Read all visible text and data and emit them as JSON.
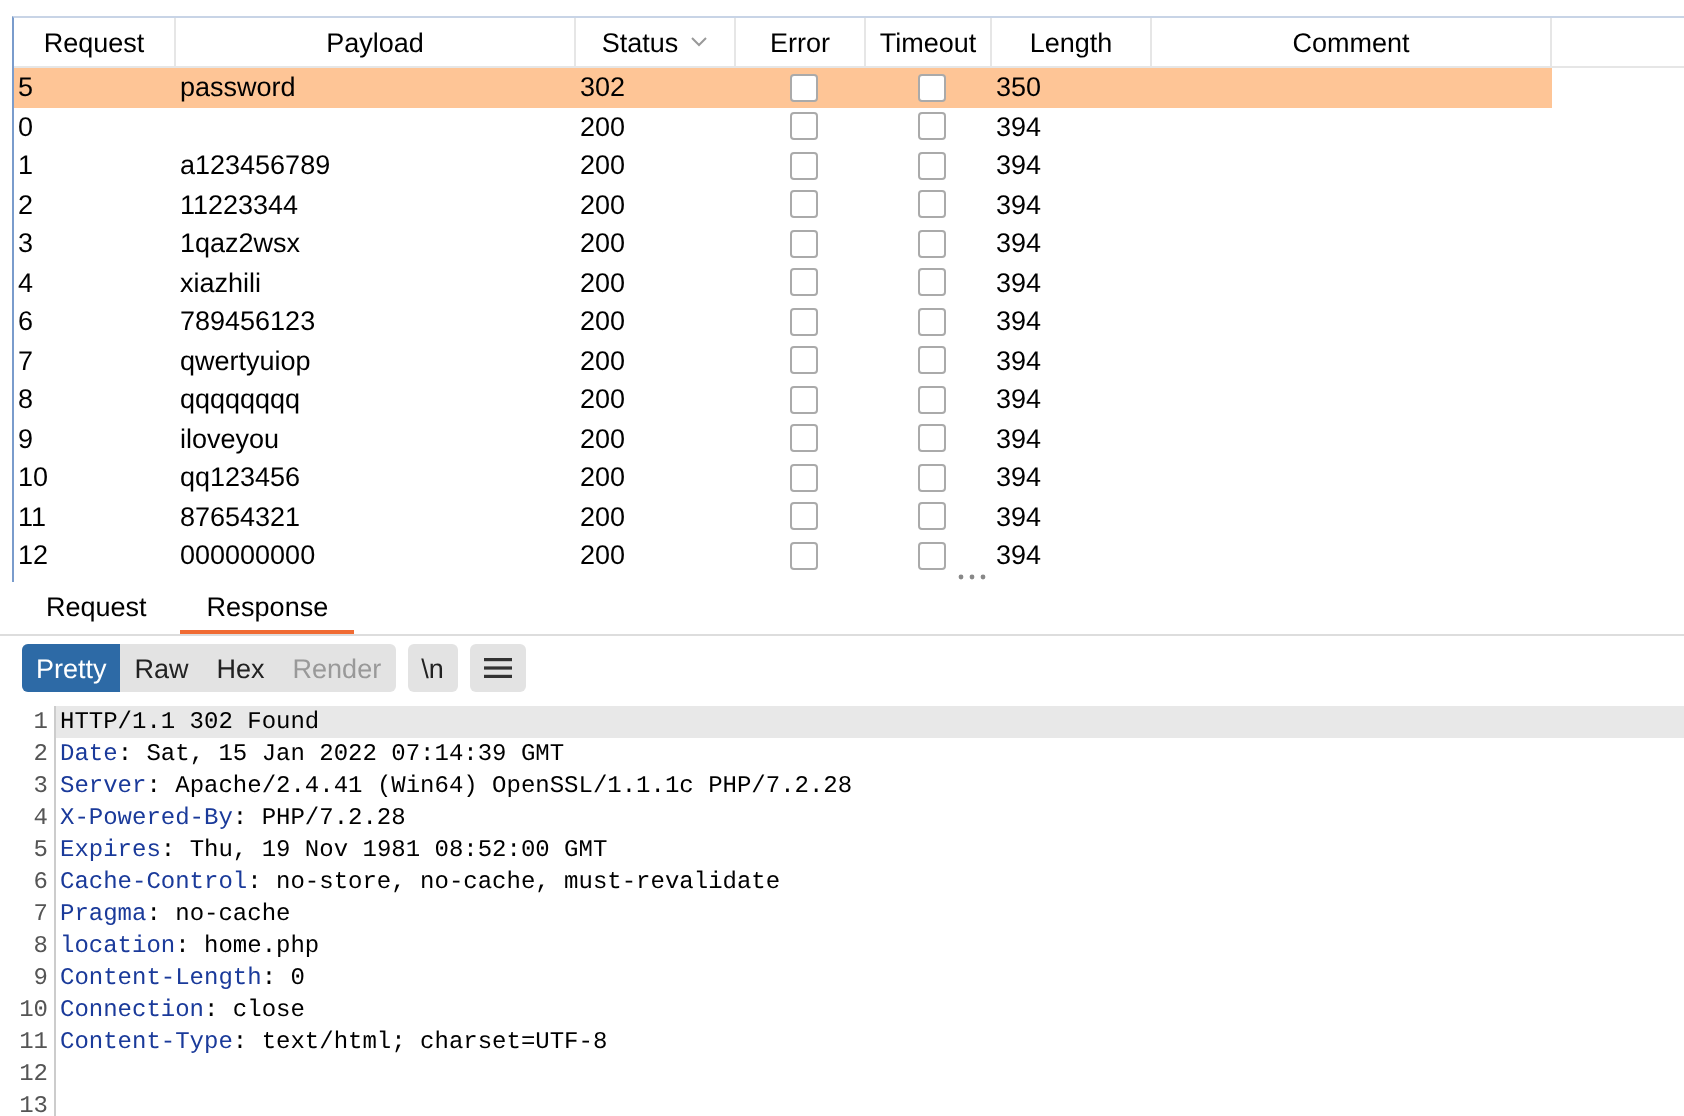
{
  "table": {
    "columns": [
      {
        "label": "Request"
      },
      {
        "label": "Payload"
      },
      {
        "label": "Status",
        "sorted": true
      },
      {
        "label": "Error"
      },
      {
        "label": "Timeout"
      },
      {
        "label": "Length"
      },
      {
        "label": "Comment"
      }
    ],
    "rows": [
      {
        "request": "5",
        "payload": "password",
        "status": "302",
        "error": false,
        "timeout": false,
        "length": "350",
        "selected": true
      },
      {
        "request": "0",
        "payload": "",
        "status": "200",
        "error": false,
        "timeout": false,
        "length": "394",
        "selected": false
      },
      {
        "request": "1",
        "payload": "a123456789",
        "status": "200",
        "error": false,
        "timeout": false,
        "length": "394",
        "selected": false
      },
      {
        "request": "2",
        "payload": "11223344",
        "status": "200",
        "error": false,
        "timeout": false,
        "length": "394",
        "selected": false
      },
      {
        "request": "3",
        "payload": "1qaz2wsx",
        "status": "200",
        "error": false,
        "timeout": false,
        "length": "394",
        "selected": false
      },
      {
        "request": "4",
        "payload": "xiazhili",
        "status": "200",
        "error": false,
        "timeout": false,
        "length": "394",
        "selected": false
      },
      {
        "request": "6",
        "payload": "789456123",
        "status": "200",
        "error": false,
        "timeout": false,
        "length": "394",
        "selected": false
      },
      {
        "request": "7",
        "payload": "qwertyuiop",
        "status": "200",
        "error": false,
        "timeout": false,
        "length": "394",
        "selected": false
      },
      {
        "request": "8",
        "payload": "qqqqqqqq",
        "status": "200",
        "error": false,
        "timeout": false,
        "length": "394",
        "selected": false
      },
      {
        "request": "9",
        "payload": "iloveyou",
        "status": "200",
        "error": false,
        "timeout": false,
        "length": "394",
        "selected": false
      },
      {
        "request": "10",
        "payload": "qq123456",
        "status": "200",
        "error": false,
        "timeout": false,
        "length": "394",
        "selected": false
      },
      {
        "request": "11",
        "payload": "87654321",
        "status": "200",
        "error": false,
        "timeout": false,
        "length": "394",
        "selected": false
      },
      {
        "request": "12",
        "payload": "000000000",
        "status": "200",
        "error": false,
        "timeout": false,
        "length": "394",
        "selected": false
      }
    ]
  },
  "tabs": [
    {
      "label": "Request",
      "selected": false
    },
    {
      "label": "Response",
      "selected": true
    }
  ],
  "view_modes": [
    {
      "label": "Pretty",
      "selected": true,
      "disabled": false
    },
    {
      "label": "Raw",
      "selected": false,
      "disabled": false
    },
    {
      "label": "Hex",
      "selected": false,
      "disabled": false
    },
    {
      "label": "Render",
      "selected": false,
      "disabled": true
    }
  ],
  "newline_button": "\\n",
  "response_lines": [
    {
      "number": "1",
      "kind": "text",
      "text": "HTTP/1.1 302 Found",
      "current": true
    },
    {
      "number": "2",
      "kind": "header",
      "name": "Date",
      "value": ": Sat, 15 Jan 2022 07:14:39 GMT",
      "current": false
    },
    {
      "number": "3",
      "kind": "header",
      "name": "Server",
      "value": ": Apache/2.4.41 (Win64) OpenSSL/1.1.1c PHP/7.2.28",
      "current": false
    },
    {
      "number": "4",
      "kind": "header",
      "name": "X-Powered-By",
      "value": ": PHP/7.2.28",
      "current": false
    },
    {
      "number": "5",
      "kind": "header",
      "name": "Expires",
      "value": ": Thu, 19 Nov 1981 08:52:00 GMT",
      "current": false
    },
    {
      "number": "6",
      "kind": "header",
      "name": "Cache-Control",
      "value": ": no-store, no-cache, must-revalidate",
      "current": false
    },
    {
      "number": "7",
      "kind": "header",
      "name": "Pragma",
      "value": ": no-cache",
      "current": false
    },
    {
      "number": "8",
      "kind": "header",
      "name": "location",
      "value": ": home.php",
      "current": false
    },
    {
      "number": "9",
      "kind": "header",
      "name": "Content-Length",
      "value": ": 0",
      "current": false
    },
    {
      "number": "10",
      "kind": "header",
      "name": "Connection",
      "value": ": close",
      "current": false
    },
    {
      "number": "11",
      "kind": "header",
      "name": "Content-Type",
      "value": ": text/html; charset=UTF-8",
      "current": false
    },
    {
      "number": "12",
      "kind": "empty",
      "current": false
    },
    {
      "number": "13",
      "kind": "empty",
      "current": false
    }
  ]
}
